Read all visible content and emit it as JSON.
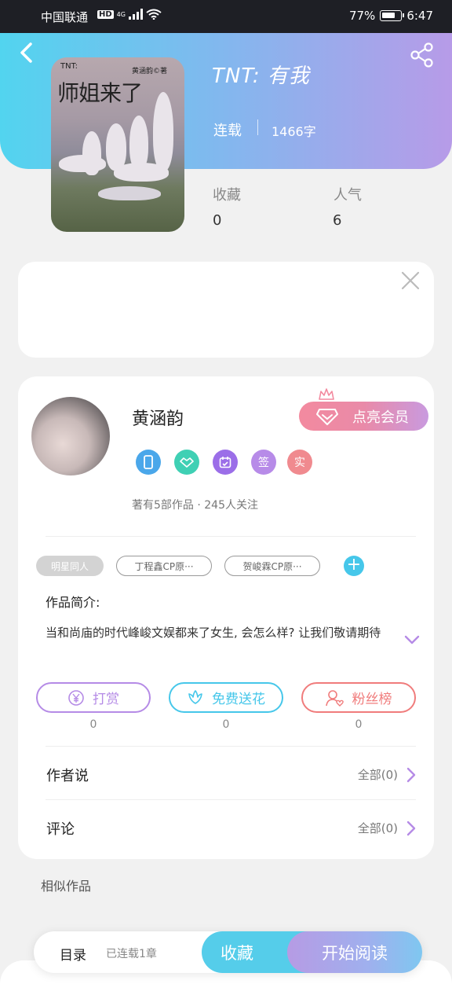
{
  "status_bar": {
    "carrier": "中国联通",
    "hd": "HD",
    "network": "4G",
    "battery_pct_text": "77%",
    "battery_level": 0.77,
    "time": "6:47"
  },
  "book": {
    "cover_small_text": "TNT:",
    "cover_author_text": "黄涵韵©著",
    "cover_title": "师姐来了",
    "title": "TNT:  有我",
    "status": "连载",
    "words": "1466字",
    "stats": [
      {
        "label": "收藏",
        "value": "0"
      },
      {
        "label": "人气",
        "value": "6"
      }
    ]
  },
  "author": {
    "name": "黄涵韵",
    "vip_label": "点亮会员",
    "badges": [
      {
        "icon": "phone-badge-icon",
        "text": "",
        "color": "#4aa7ea"
      },
      {
        "icon": "handshake-badge-icon",
        "text": "",
        "color": "#3fd0b4"
      },
      {
        "icon": "calendar-badge-icon",
        "text": "",
        "color": "#9b6ee8"
      },
      {
        "icon": "sign-badge-icon",
        "text": "签",
        "color": "#b78be8"
      },
      {
        "icon": "verified-badge-icon",
        "text": "实",
        "color": "#f08a8f"
      }
    ],
    "meta": "著有5部作品 · 245人关注"
  },
  "tags": [
    {
      "label": "明星同人",
      "style": "filled"
    },
    {
      "label": "丁程鑫CP原···",
      "style": "outline"
    },
    {
      "label": "贺峻霖CP原···",
      "style": "outline"
    }
  ],
  "intro": {
    "label": "作品简介:",
    "text": "当和尚庙的时代峰峻文娱都来了女生, 会怎么样? 让我们敬请期待"
  },
  "actions": [
    {
      "label": "打赏",
      "count": "0",
      "icon": "yen-coin-icon",
      "color": "#b58be6"
    },
    {
      "label": "免费送花",
      "count": "0",
      "icon": "flower-icon",
      "color": "#46c7ea"
    },
    {
      "label": "粉丝榜",
      "count": "0",
      "icon": "fan-user-icon",
      "color": "#f07c7c"
    }
  ],
  "rows": [
    {
      "title": "作者说",
      "more": "全部(0)"
    },
    {
      "title": "评论",
      "more": "全部(0)"
    }
  ],
  "similar_label": "相似作品",
  "bottom_bar": {
    "toc_label": "目录",
    "toc_sub": "已连载1章",
    "favorite_label": "收藏",
    "read_label": "开始阅读"
  },
  "colors": {
    "accent_blue": "#55cdea",
    "accent_purple": "#b79be8",
    "vip_pink": "#f38a9f"
  }
}
